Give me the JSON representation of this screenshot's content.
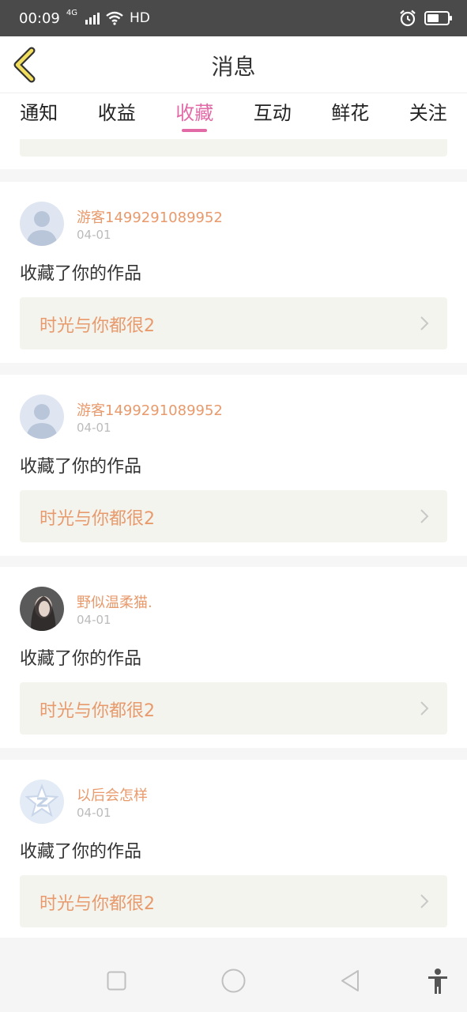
{
  "status_bar": {
    "time": "00:09",
    "network": "4G",
    "hd_label": "HD"
  },
  "header": {
    "title": "消息"
  },
  "tabs": [
    {
      "label": "通知",
      "active": false
    },
    {
      "label": "收益",
      "active": false
    },
    {
      "label": "收藏",
      "active": true
    },
    {
      "label": "互动",
      "active": false
    },
    {
      "label": "鲜花",
      "active": false
    },
    {
      "label": "关注",
      "active": false
    }
  ],
  "notifications": [
    {
      "username": "游客1499291089952",
      "date": "04-01",
      "action": "收藏了你的作品",
      "work_title": "时光与你都很2",
      "avatar": "default-avatar-icon"
    },
    {
      "username": "游客1499291089952",
      "date": "04-01",
      "action": "收藏了你的作品",
      "work_title": "时光与你都很2",
      "avatar": "default-avatar-icon"
    },
    {
      "username": "野似温柔猫.",
      "date": "04-01",
      "action": "收藏了你的作品",
      "work_title": "时光与你都很2",
      "avatar": "photo-avatar"
    },
    {
      "username": "以后会怎样",
      "date": "04-01",
      "action": "收藏了你的作品",
      "work_title": "时光与你都很2",
      "avatar": "qzone-avatar-icon"
    }
  ],
  "colors": {
    "accent": "#e26aa7",
    "username": "#e89a6c",
    "book_box": "#f4f4ee",
    "back_arrow": "#f2df5f"
  }
}
